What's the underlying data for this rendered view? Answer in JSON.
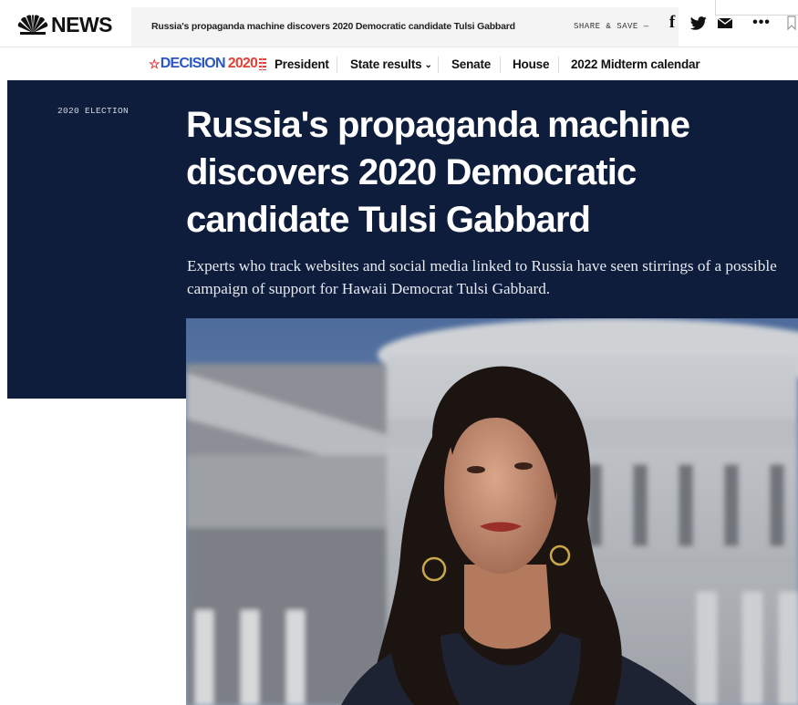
{
  "header": {
    "logo_text": "NEWS",
    "logo_icon": "nbc-peacock-icon",
    "article_title": "Russia's propaganda machine discovers 2020 Democratic candidate Tulsi Gabbard",
    "share_label": "SHARE & SAVE —",
    "share_icons": [
      "facebook-icon",
      "twitter-icon",
      "email-icon",
      "more-icon",
      "bookmark-icon"
    ],
    "facebook_glyph": "f",
    "more_glyph": "•••"
  },
  "nav": {
    "decision_word": "DECISION",
    "decision_year": "2020",
    "items": [
      {
        "label": "President",
        "dropdown": false
      },
      {
        "label": "State results",
        "dropdown": true
      },
      {
        "label": "Senate",
        "dropdown": false
      },
      {
        "label": "House",
        "dropdown": false
      },
      {
        "label": "2022 Midterm calendar",
        "dropdown": false
      }
    ]
  },
  "article": {
    "eyebrow": "2020 ELECTION",
    "headline_lines": [
      "Russia's propaganda machine",
      "discovers 2020 Democratic",
      "candidate Tulsi Gabbard"
    ],
    "dek": "Experts who track websites and social media linked to Russia have seen stirrings of a possible campaign of support for Hawaii Democrat Tulsi Gabbard."
  },
  "colors": {
    "hero_background": "#0f1d3d",
    "decision_blue": "#2a56c6",
    "decision_red": "#e0413a"
  }
}
